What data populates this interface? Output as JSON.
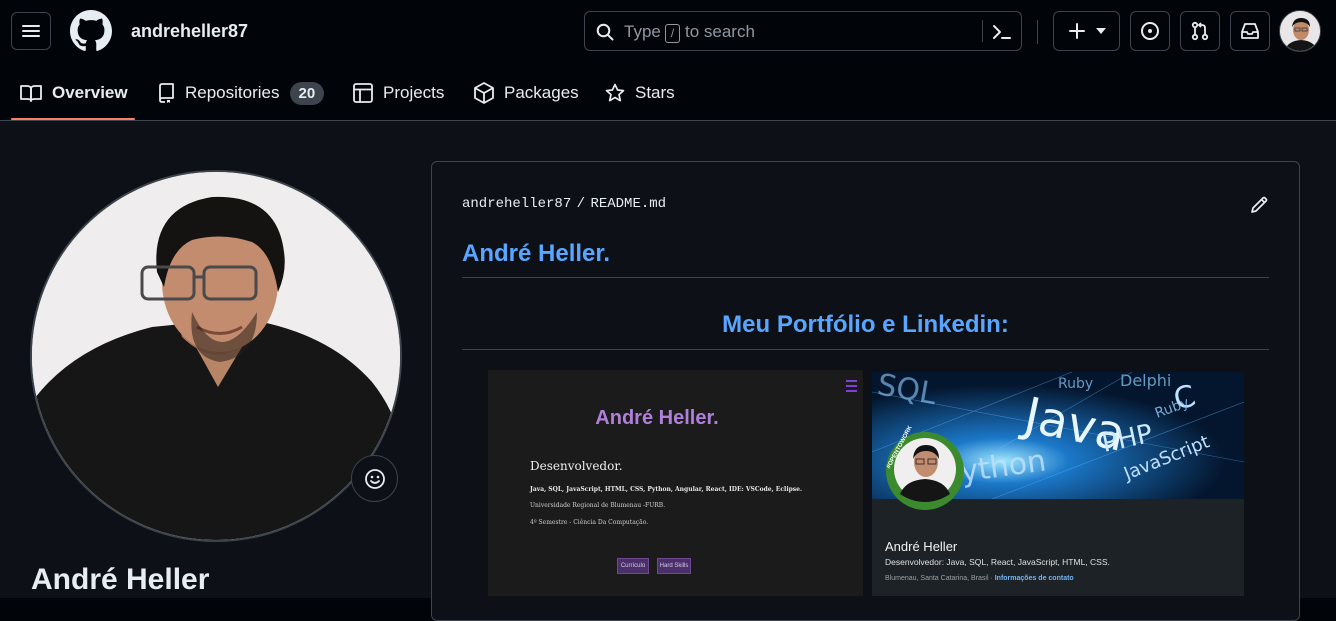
{
  "header": {
    "username": "andreheller87",
    "search_prefix": "Type",
    "search_key": "/",
    "search_suffix": "to search"
  },
  "nav": {
    "tabs": [
      {
        "label": "Overview"
      },
      {
        "label": "Repositories",
        "count": "20"
      },
      {
        "label": "Projects"
      },
      {
        "label": "Packages"
      },
      {
        "label": "Stars"
      }
    ]
  },
  "profile": {
    "name": "André Heller"
  },
  "readme": {
    "path_user": "andreheller87",
    "path_sep": "/",
    "path_file": "README.md",
    "h1": "André Heller.",
    "h2": "Meu Portfólio e Linkedin:"
  },
  "portfolio_card": {
    "title": "André Heller.",
    "role": "Desenvolvedor.",
    "skills": "Java, SQL, JavaScript, HTML, CSS, Python, Angular, React, IDE: VSCode, Eclipse.",
    "university": "Universidade Regional de Blumenau -FURB.",
    "semester": "4º Semestre - Ciência Da Computação.",
    "btn1": "Currículo",
    "btn2": "Hard Skills"
  },
  "linkedin_card": {
    "name": "André Heller",
    "headline": "Desenvolvedor: Java, SQL, React, JavaScript, HTML, CSS.",
    "location": "Blumenau, Santa Catarina, Brasil",
    "location_sep": " · ",
    "contact": "Informações de contato",
    "badge": "#OPENTOWORK",
    "banner_words": [
      "SQL",
      "Java",
      "PHP",
      "JavaScript",
      "Ruby",
      "C",
      "ython",
      "Ruby",
      "Delphi"
    ]
  },
  "colors": {
    "accent": "#f78166",
    "link": "#4493f8",
    "heading": "#58a6ff",
    "purple": "#b07fd9",
    "opentowork": "#3b8b2e"
  }
}
